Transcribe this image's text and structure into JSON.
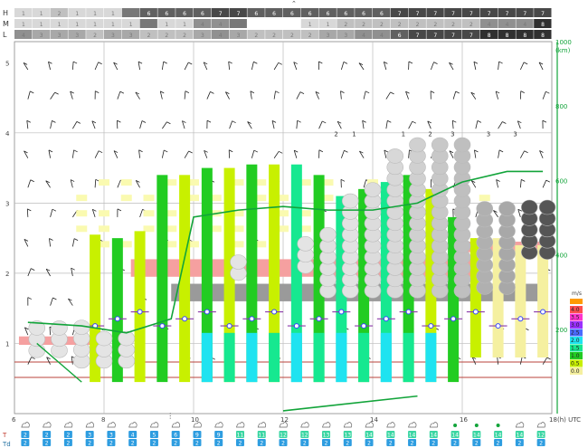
{
  "cloud_rows": [
    {
      "label": "H",
      "values": [
        "1",
        "1",
        "2",
        "1",
        "1",
        "1",
        "5",
        "6",
        "6",
        "6",
        "6",
        "7",
        "7",
        "6",
        "6",
        "6",
        "6",
        "6",
        "6",
        "6",
        "6",
        "7",
        "7",
        "7",
        "7",
        "7",
        "7",
        "7",
        "7",
        "7"
      ]
    },
    {
      "label": "M",
      "values": [
        "1",
        "1",
        "1",
        "1",
        "1",
        "1",
        "1",
        "5",
        "1",
        "1",
        "4",
        "4",
        "5",
        "",
        "",
        "",
        "1",
        "1",
        "2",
        "2",
        "2",
        "2",
        "2",
        "2",
        "2",
        "2",
        "4",
        "4",
        "4",
        "8"
      ]
    },
    {
      "label": "L",
      "values": [
        "4",
        "3",
        "3",
        "3",
        "2",
        "3",
        "3",
        "2",
        "2",
        "2",
        "3",
        "4",
        "3",
        "2",
        "2",
        "2",
        "2",
        "3",
        "3",
        "4",
        "4",
        "6",
        "7",
        "7",
        "7",
        "7",
        "8",
        "8",
        "8",
        "8"
      ]
    }
  ],
  "chart_data": {
    "type": "meteogram",
    "left_scale_labels": [
      "5",
      "4",
      "3",
      "2",
      "1"
    ],
    "right_axis": {
      "label_top": "1000",
      "label_unit": "(km)",
      "ticks": [
        "800",
        "600",
        "400",
        "200"
      ]
    },
    "x_ticks": [
      "6",
      "8",
      "10",
      "12",
      "14",
      "16",
      "18"
    ],
    "x_unit": "(h) UTC",
    "legend": {
      "title": "m/s",
      "entries": [
        {
          "label": "4.0",
          "color": "#ff4f4f"
        },
        {
          "label": "3.5",
          "color": "#ff33cc"
        },
        {
          "label": "3.0",
          "color": "#9b30ff"
        },
        {
          "label": "2.5",
          "color": "#4b6bff"
        },
        {
          "label": "2.0",
          "color": "#1fe3f0"
        },
        {
          "label": "1.5",
          "color": "#16e890"
        },
        {
          "label": "1.0",
          "color": "#22cc22"
        },
        {
          "label": "0.5",
          "color": "#c8f000"
        },
        {
          "label": "0.0",
          "color": "#f5f0a0"
        }
      ]
    },
    "updraft_columns": [
      {
        "hour": 7.8,
        "top": 2.55,
        "bottom": 0.45,
        "color": "#c8f000"
      },
      {
        "hour": 8.3,
        "top": 2.5,
        "bottom": 0.45,
        "color": "#22cc22"
      },
      {
        "hour": 8.8,
        "top": 2.6,
        "bottom": 0.45,
        "color": "#c8f000"
      },
      {
        "hour": 9.3,
        "top": 3.4,
        "bottom": 0.45,
        "color": "#22cc22"
      },
      {
        "hour": 9.8,
        "top": 3.4,
        "bottom": 0.45,
        "color": "#c8f000"
      },
      {
        "hour": 10.3,
        "top": 3.5,
        "bottom": 0.45,
        "color": "#22cc22"
      },
      {
        "hour": 10.8,
        "top": 3.5,
        "bottom": 0.45,
        "color": "#c8f000"
      },
      {
        "hour": 11.3,
        "top": 3.55,
        "bottom": 0.45,
        "color": "#22cc22"
      },
      {
        "hour": 11.8,
        "top": 3.55,
        "bottom": 0.45,
        "color": "#c8f000"
      },
      {
        "hour": 12.3,
        "top": 3.55,
        "bottom": 0.45,
        "color": "#16e890"
      },
      {
        "hour": 12.8,
        "top": 3.4,
        "bottom": 0.45,
        "color": "#22cc22"
      },
      {
        "hour": 13.3,
        "top": 3.1,
        "bottom": 0.45,
        "color": "#16e890"
      },
      {
        "hour": 13.8,
        "top": 3.2,
        "bottom": 0.45,
        "color": "#22cc22"
      },
      {
        "hour": 14.3,
        "top": 3.3,
        "bottom": 0.45,
        "color": "#16e890"
      },
      {
        "hour": 14.8,
        "top": 3.4,
        "bottom": 0.45,
        "color": "#22cc22"
      },
      {
        "hour": 15.3,
        "top": 3.2,
        "bottom": 0.45,
        "color": "#c8f000"
      },
      {
        "hour": 15.8,
        "top": 2.8,
        "bottom": 0.45,
        "color": "#22cc22"
      },
      {
        "hour": 16.3,
        "top": 2.5,
        "bottom": 0.8,
        "color": "#c8f000"
      },
      {
        "hour": 16.8,
        "top": 2.5,
        "bottom": 0.8,
        "color": "#f5f0a0"
      },
      {
        "hour": 17.3,
        "top": 2.4,
        "bottom": 0.8,
        "color": "#f5f0a0"
      },
      {
        "hour": 17.8,
        "top": 2.4,
        "bottom": 0.8,
        "color": "#f5f0a0"
      }
    ],
    "boundary_layer_line": [
      [
        6.3,
        1.3
      ],
      [
        7.5,
        1.25
      ],
      [
        8.5,
        1.15
      ],
      [
        9.5,
        1.35
      ],
      [
        10.0,
        2.8
      ],
      [
        11.0,
        2.9
      ],
      [
        12.0,
        2.95
      ],
      [
        13.0,
        2.9
      ],
      [
        14.0,
        2.9
      ],
      [
        15.0,
        3.0
      ],
      [
        16.0,
        3.3
      ],
      [
        17.0,
        3.45
      ],
      [
        17.8,
        3.45
      ]
    ],
    "cumulus_labels": [
      {
        "hour": 14.7,
        "value": "1"
      },
      {
        "hour": 15.3,
        "value": "2"
      },
      {
        "hour": 15.8,
        "value": "3"
      },
      {
        "hour": 13.6,
        "value": "1"
      },
      {
        "hour": 13.2,
        "value": "2"
      },
      {
        "hour": 16.6,
        "value": "3"
      },
      {
        "hour": 17.2,
        "value": "3"
      }
    ],
    "precip_line": [
      [
        12.0,
        0.04
      ],
      [
        15.0,
        0.25
      ]
    ],
    "bottom_rows": {
      "T": [
        "2",
        "2",
        "2",
        "3",
        "3",
        "4",
        "5",
        "6",
        "9",
        "9",
        "11",
        "11",
        "12",
        "12",
        "13",
        "13",
        "14",
        "14",
        "14",
        "14",
        "14",
        "14",
        "14",
        "14",
        "12"
      ],
      "Td": [
        "2",
        "2",
        "2",
        "2",
        "2",
        "2",
        "2",
        "2",
        "2",
        "2",
        "2",
        "2",
        "2",
        "2",
        "2",
        "2",
        "2",
        "2",
        "2",
        "2",
        "2",
        "2",
        "2",
        "2",
        "2"
      ]
    }
  }
}
